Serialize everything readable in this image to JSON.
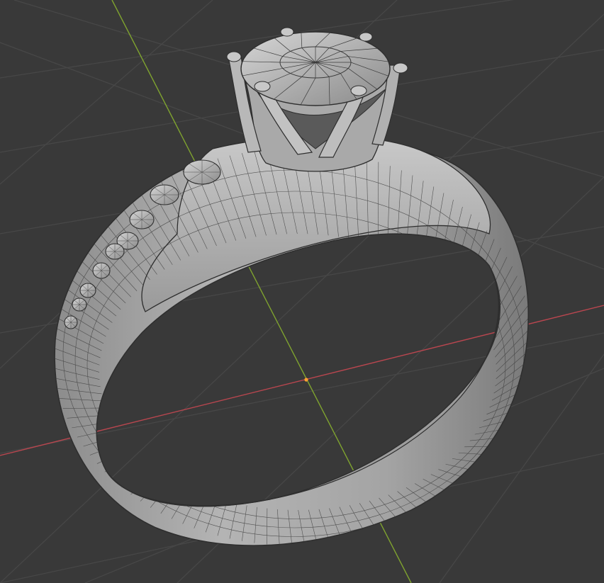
{
  "viewport": {
    "mode": "3d-viewport",
    "shading": "solid-wireframe-overlay",
    "background_color": "#393939",
    "grid_color": "#4a4a4a",
    "axis_x_color": "#b9464f",
    "axis_y_color": "#7fa32f",
    "origin_color": "#ffa230"
  },
  "object": {
    "type": "ring-mesh",
    "base_color": "#9e9e9e",
    "highlight_color": "#cfcfcf",
    "shadow_color": "#5c5c5c",
    "edge_color": "#3a3a3a",
    "side_stone_count": 9
  }
}
